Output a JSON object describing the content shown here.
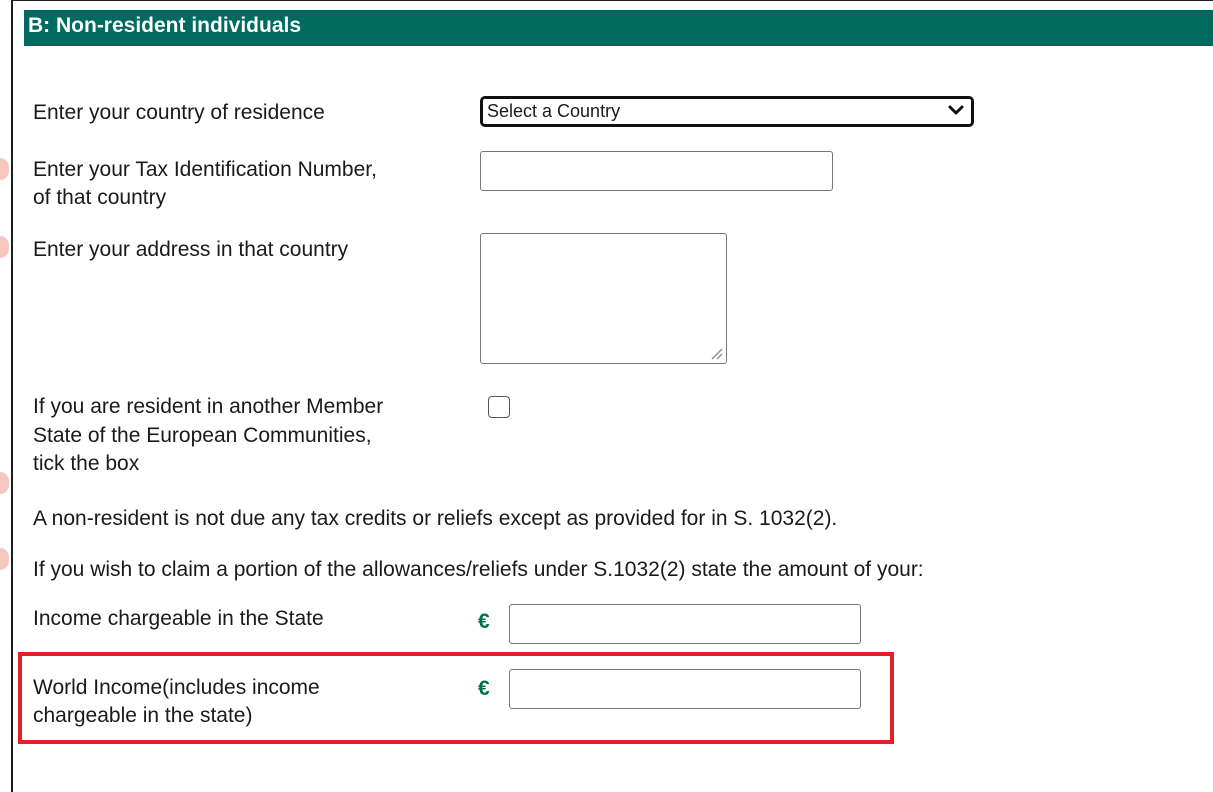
{
  "section": {
    "title": "B: Non-resident individuals"
  },
  "fields": {
    "country": {
      "label": "Enter your country of residence",
      "selected": "Select a Country"
    },
    "tin": {
      "label_line1": "Enter your Tax Identification Number,",
      "label_line2": "of that country",
      "value": ""
    },
    "address": {
      "label": "Enter your address in that country",
      "value": ""
    },
    "eu_resident": {
      "label_line1": "If you are resident in another Member",
      "label_line2": "State of the European Communities,",
      "label_line3": "tick the box",
      "checked": false
    },
    "income_state": {
      "label": "Income chargeable in the State",
      "currency": "€",
      "value": ""
    },
    "world_income": {
      "label_line1": "World Income(includes income",
      "label_line2": "chargeable in the state)",
      "currency": "€",
      "value": ""
    }
  },
  "notes": {
    "non_resident": "A non-resident is not due any tax credits or reliefs except as provided for in S. 1032(2).",
    "claim": "If you wish to claim a portion of the allowances/reliefs under S.1032(2) state the amount of your:"
  },
  "colors": {
    "header_bg": "#006a60",
    "euro": "#00704a",
    "highlight": "#e2202c"
  }
}
